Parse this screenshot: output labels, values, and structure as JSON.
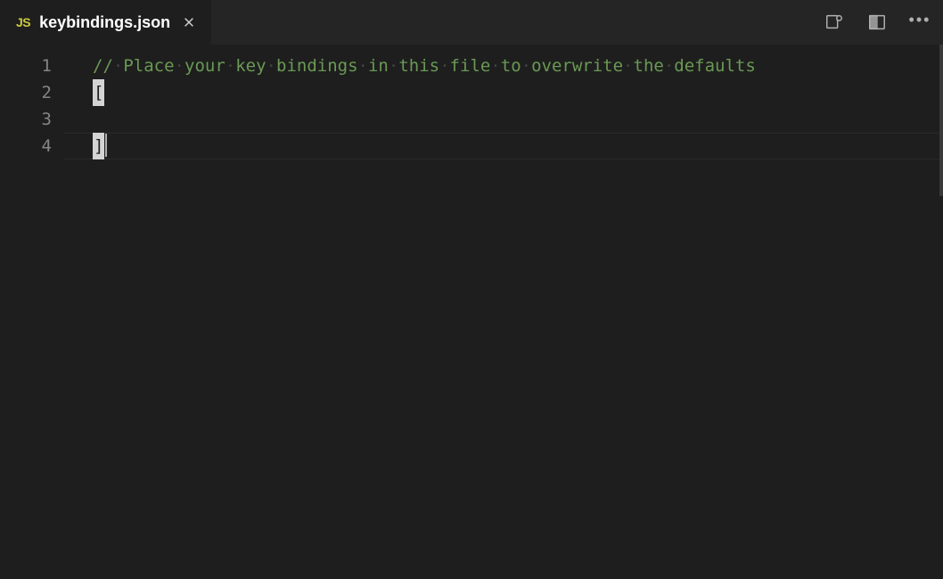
{
  "tabbar": {
    "active_tab": {
      "icon": "JS",
      "filename": "keybindings.json"
    }
  },
  "editor": {
    "gutter": [
      "1",
      "2",
      "3",
      "4"
    ],
    "lines": {
      "comment_text": "// Place your key bindings in this file to overwrite the defaults",
      "line2": "[",
      "line3": "",
      "line4": "]"
    },
    "whitespace_dot": "·",
    "current_line": 4
  }
}
